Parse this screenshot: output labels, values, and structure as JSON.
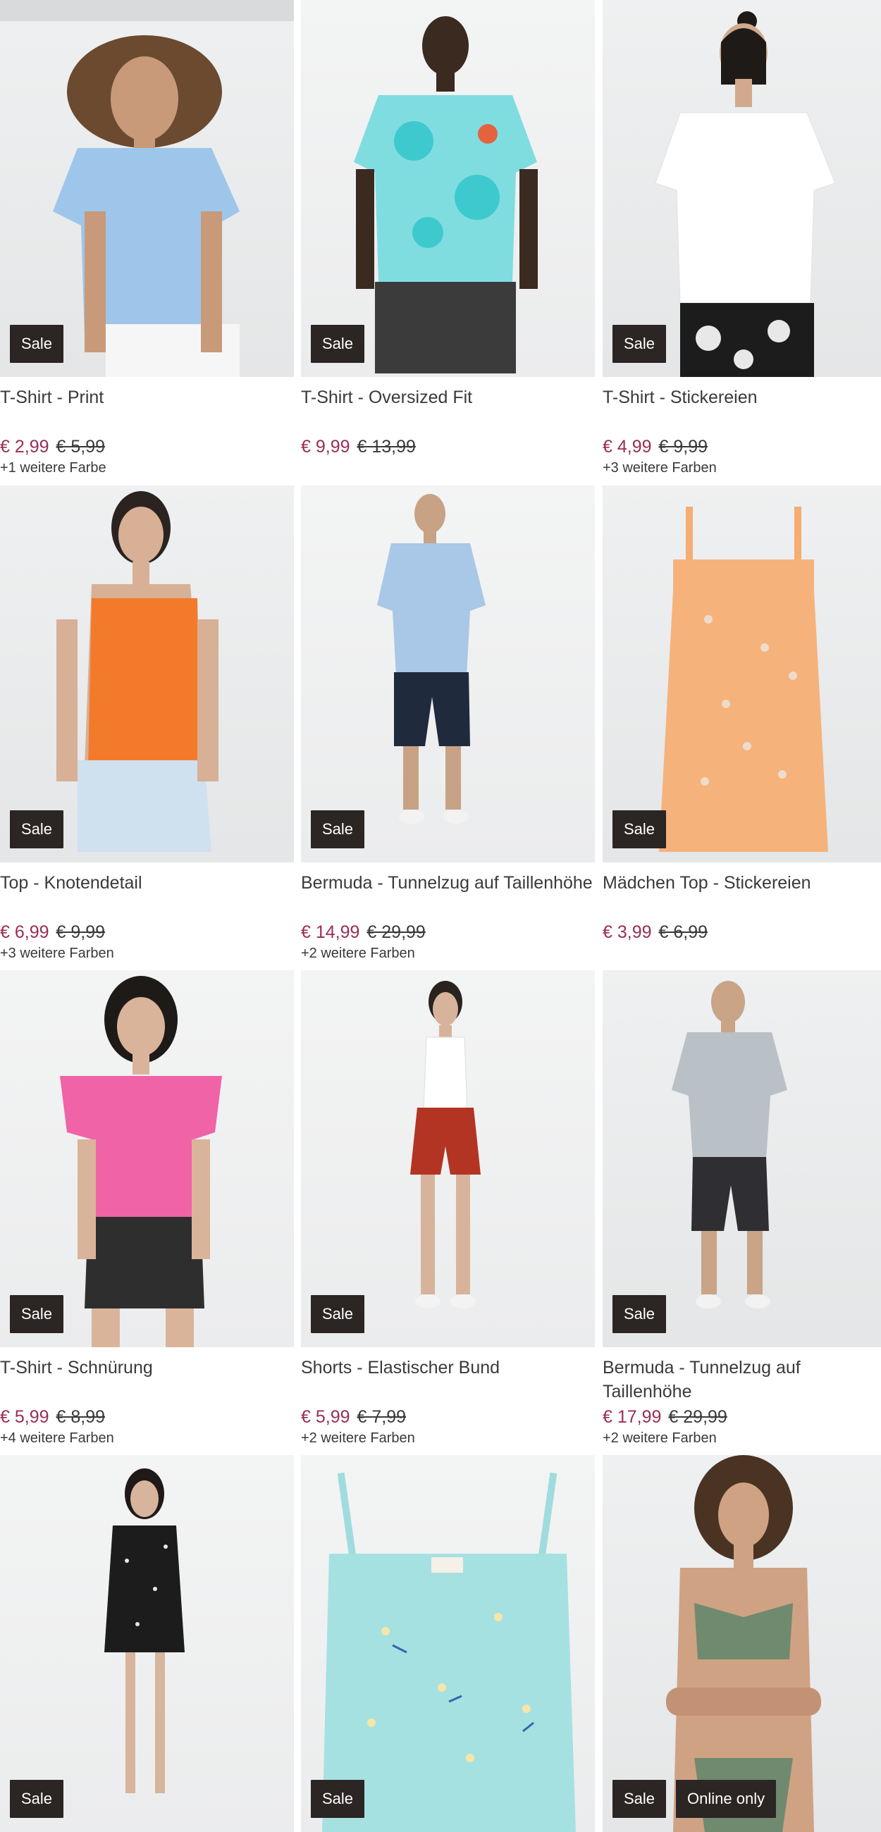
{
  "products": [
    {
      "title": "T-Shirt - Print",
      "price": "€ 2,99",
      "old_price": "€ 5,99",
      "colors": "+1 weitere Farbe",
      "badges": [
        "Sale"
      ]
    },
    {
      "title": "T-Shirt - Oversized Fit",
      "price": "€ 9,99",
      "old_price": "€ 13,99",
      "colors": "",
      "badges": [
        "Sale"
      ]
    },
    {
      "title": "T-Shirt - Stickereien",
      "price": "€ 4,99",
      "old_price": "€ 9,99",
      "colors": "+3 weitere Farben",
      "badges": [
        "Sale"
      ]
    },
    {
      "title": "Top - Knotendetail",
      "price": "€ 6,99",
      "old_price": "€ 9,99",
      "colors": "+3 weitere Farben",
      "badges": [
        "Sale"
      ]
    },
    {
      "title": "Bermuda - Tunnelzug auf Taillenhöhe",
      "price": "€ 14,99",
      "old_price": "€ 29,99",
      "colors": "+2 weitere Farben",
      "badges": [
        "Sale"
      ]
    },
    {
      "title": "Mädchen Top - Stickereien",
      "price": "€ 3,99",
      "old_price": "€ 6,99",
      "colors": "",
      "badges": [
        "Sale"
      ]
    },
    {
      "title": "T-Shirt - Schnürung",
      "price": "€ 5,99",
      "old_price": "€ 8,99",
      "colors": "+4 weitere Farben",
      "badges": [
        "Sale"
      ]
    },
    {
      "title": "Shorts - Elastischer Bund",
      "price": "€ 5,99",
      "old_price": "€ 7,99",
      "colors": "+2 weitere Farben",
      "badges": [
        "Sale"
      ]
    },
    {
      "title": "Bermuda - Tunnelzug auf Taillenhöhe",
      "price": "€ 17,99",
      "old_price": "€ 29,99",
      "colors": "+2 weitere Farben",
      "badges": [
        "Sale"
      ]
    },
    {
      "title": "",
      "price": "",
      "old_price": "",
      "colors": "",
      "badges": [
        "Sale"
      ]
    },
    {
      "title": "",
      "price": "",
      "old_price": "",
      "colors": "",
      "badges": [
        "Sale"
      ]
    },
    {
      "title": "",
      "price": "",
      "old_price": "",
      "colors": "",
      "badges": [
        "Sale",
        "Online only"
      ]
    }
  ],
  "colors": {
    "sale_price": "#9a2d55",
    "badge_bg": "#2b2523",
    "text": "#3a3a3a"
  }
}
